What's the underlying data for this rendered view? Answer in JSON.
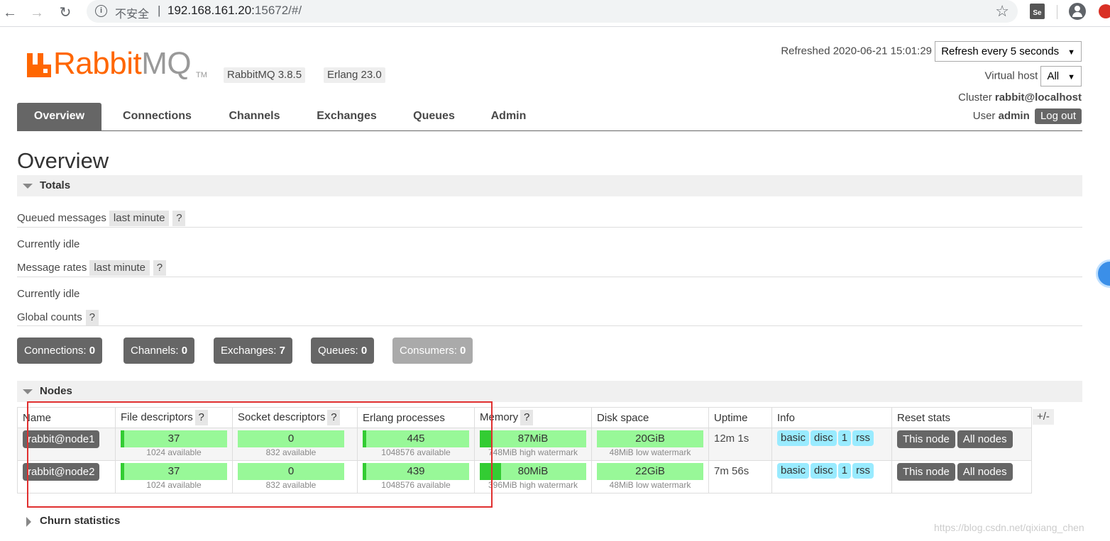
{
  "browser": {
    "insecure_label": "不安全",
    "separator": "|",
    "url_host": "192.168.161.20:",
    "url_rest": "15672/#/",
    "ext_se_label": "Se"
  },
  "header": {
    "logo_rabbit": "Rabbit",
    "logo_mq": "MQ",
    "logo_tm": "TM",
    "version_rabbitmq": "RabbitMQ 3.8.5",
    "version_erlang": "Erlang 23.0",
    "refreshed": "Refreshed 2020-06-21 15:01:29",
    "refresh_select": "Refresh every 5 seconds",
    "virtual_host_label": "Virtual host",
    "virtual_host_value": "All",
    "cluster_label": "Cluster",
    "cluster_value": "rabbit@localhost",
    "user_label": "User",
    "user_value": "admin",
    "logout": "Log out"
  },
  "tabs": [
    {
      "label": "Overview"
    },
    {
      "label": "Connections"
    },
    {
      "label": "Channels"
    },
    {
      "label": "Exchanges"
    },
    {
      "label": "Queues"
    },
    {
      "label": "Admin"
    }
  ],
  "page_title": "Overview",
  "totals": {
    "header": "Totals",
    "queued_label": "Queued messages",
    "queued_range": "last minute",
    "help": "?",
    "idle1": "Currently idle",
    "rates_label": "Message rates",
    "rates_range": "last minute",
    "idle2": "Currently idle",
    "global_label": "Global counts",
    "counts": [
      {
        "label": "Connections:",
        "value": "0"
      },
      {
        "label": "Channels:",
        "value": "0"
      },
      {
        "label": "Exchanges:",
        "value": "7"
      },
      {
        "label": "Queues:",
        "value": "0"
      },
      {
        "label": "Consumers:",
        "value": "0"
      }
    ]
  },
  "nodes": {
    "header": "Nodes",
    "columns": [
      "Name",
      "File descriptors",
      "Socket descriptors",
      "Erlang processes",
      "Memory",
      "Disk space",
      "Uptime",
      "Info",
      "Reset stats"
    ],
    "plus_minus": "+/-",
    "rows": [
      {
        "name": "rabbit@node1",
        "fd": "37",
        "fd_sub": "1024 available",
        "fd_frac": 0.036,
        "sd": "0",
        "sd_sub": "832 available",
        "sd_frac": 0,
        "ep": "445",
        "ep_sub": "1048576 available",
        "ep_frac": 0.0004,
        "mem": "87MiB",
        "mem_sub": "748MiB high watermark",
        "mem_frac": 0.116,
        "disk": "20GiB",
        "disk_sub": "48MiB low watermark",
        "uptime": "12m 1s",
        "info": [
          "basic",
          "disc",
          "1",
          "rss"
        ],
        "reset_this": "This node",
        "reset_all": "All nodes"
      },
      {
        "name": "rabbit@node2",
        "fd": "37",
        "fd_sub": "1024 available",
        "fd_frac": 0.036,
        "sd": "0",
        "sd_sub": "832 available",
        "sd_frac": 0,
        "ep": "439",
        "ep_sub": "1048576 available",
        "ep_frac": 0.0004,
        "mem": "80MiB",
        "mem_sub": "396MiB high watermark",
        "mem_frac": 0.202,
        "disk": "22GiB",
        "disk_sub": "48MiB low watermark",
        "uptime": "7m 56s",
        "info": [
          "basic",
          "disc",
          "1",
          "rss"
        ],
        "reset_this": "This node",
        "reset_all": "All nodes"
      }
    ]
  },
  "churn": {
    "header": "Churn statistics"
  },
  "watermark": "https://blog.csdn.net/qixiang_chen"
}
